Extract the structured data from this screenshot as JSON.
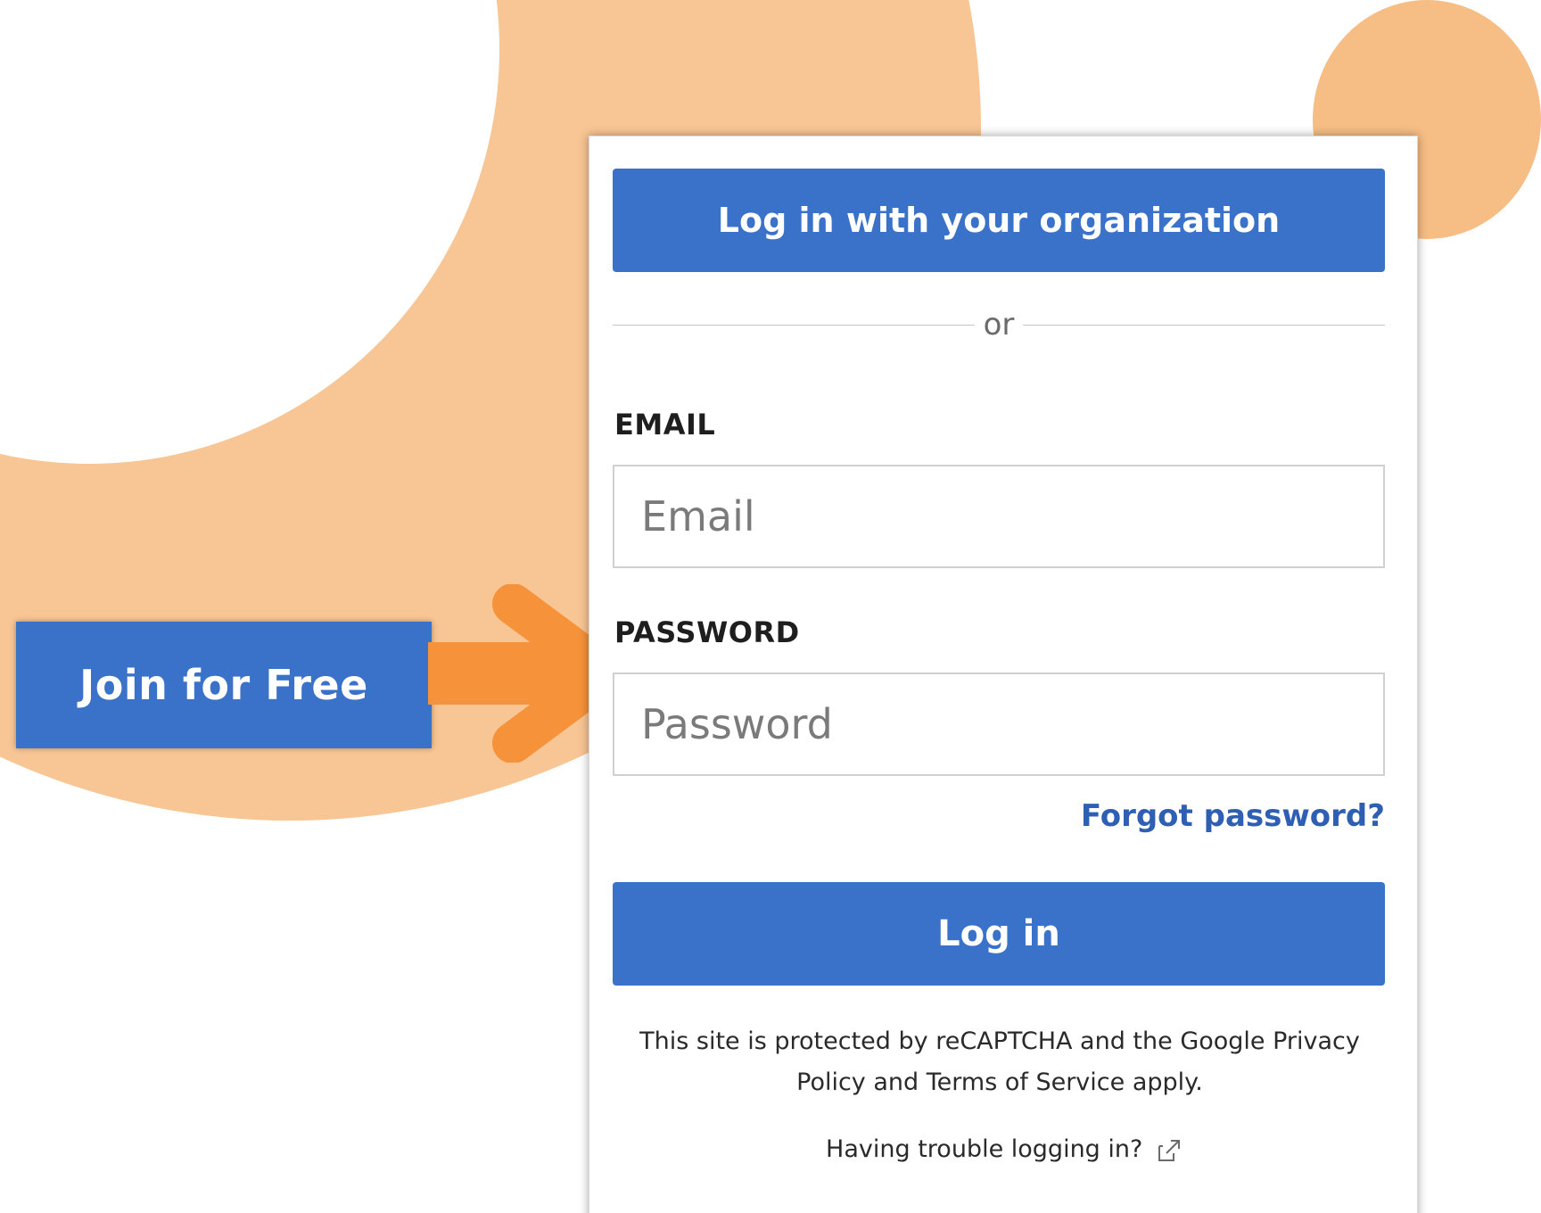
{
  "colors": {
    "accent": "#3b72c9",
    "link": "#2f5fb3",
    "decor_orange": "#f8c594",
    "arrow_orange": "#f6923a"
  },
  "join": {
    "label": "Join for Free"
  },
  "login_form": {
    "org_button_label": "Log in with your organization",
    "divider_text": "or",
    "email": {
      "label": "EMAIL",
      "placeholder": "Email",
      "value": ""
    },
    "password": {
      "label": "PASSWORD",
      "placeholder": "Password",
      "value": ""
    },
    "forgot_link": "Forgot password?",
    "submit_label": "Log in",
    "legal_text": "This site is protected by reCAPTCHA and the Google Privacy Policy and Terms of Service apply.",
    "trouble_link": "Having trouble logging in?",
    "trouble_icon": "external-link-icon"
  },
  "decor": {
    "arrow_icon": "arrow-right-icon"
  }
}
